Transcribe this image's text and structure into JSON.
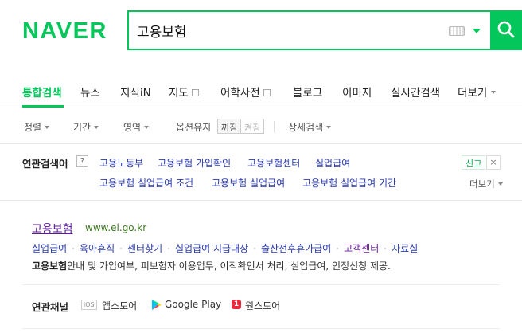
{
  "header": {
    "logo": "NAVER",
    "search_value": "고용보험"
  },
  "tabs": [
    {
      "label": "통합검색",
      "active": true
    },
    {
      "label": "뉴스"
    },
    {
      "label": "지식iN"
    },
    {
      "label": "지도"
    },
    {
      "label": "어학사전"
    },
    {
      "label": "블로그"
    },
    {
      "label": "이미지"
    },
    {
      "label": "실시간검색"
    },
    {
      "label": "더보기"
    }
  ],
  "options": {
    "sort": "정렬",
    "period": "기간",
    "area": "영역",
    "option_keep": "옵션유지",
    "keep_on": "꺼짐",
    "keep_off": "켜짐",
    "detail_search": "상세검색"
  },
  "related": {
    "title": "연관검색어",
    "help": "?",
    "keywords_row1": [
      "고용노동부",
      "고용보험 가입확인",
      "고용보험센터",
      "실업급여"
    ],
    "keywords_row2": [
      "고용보험 실업급여 조건",
      "고용보험 실업급여",
      "고용보험 실업급여 기간"
    ],
    "report": "신고",
    "close": "×",
    "more": "더보기"
  },
  "result": {
    "title": "고용보험",
    "url": "www.ei.go.kr",
    "sitelinks": [
      "실업급여",
      "육아휴직",
      "센터찾기",
      "실업급여 지급대상",
      "출산전후휴가급여",
      "고객센터",
      "자료실"
    ],
    "desc_bold": "고용보험",
    "desc": "안내 및 가입여부, 피보험자 이용업무, 이직확인서 처리, 실업급여, 인정신청 제공."
  },
  "channels": {
    "title": "연관채널",
    "ios_badge": "iOS",
    "app_store": "앱스토어",
    "google_play": "Google Play",
    "one_badge": "1",
    "one_store": "원스토어"
  },
  "colors": {
    "brand": "#03c75a",
    "link": "#2a3bb0",
    "visited": "#6a1b9a",
    "url": "#3d7a20"
  }
}
